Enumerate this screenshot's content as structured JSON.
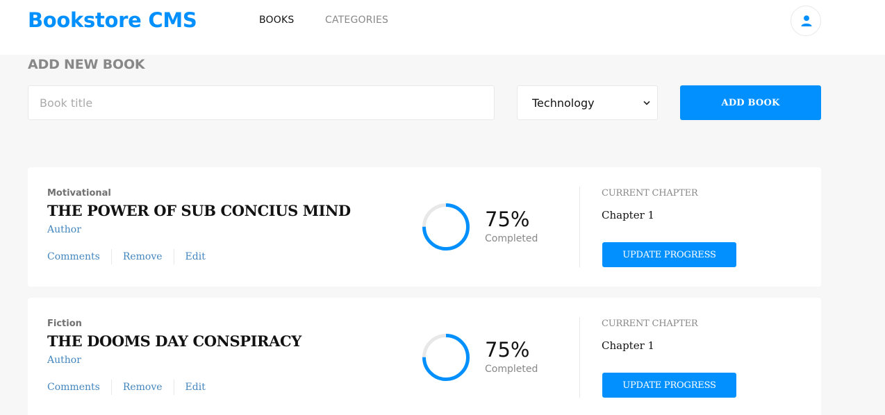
{
  "header": {
    "logo": "Bookstore CMS",
    "nav": [
      {
        "label": "BOOKS",
        "active": true
      },
      {
        "label": "CATEGORIES",
        "active": false
      }
    ],
    "user_icon": "user-icon"
  },
  "form": {
    "title": "ADD NEW BOOK",
    "title_placeholder": "Book title",
    "title_value": "",
    "category_selected": "Technology",
    "submit_label": "ADD BOOK"
  },
  "books": [
    {
      "category": "Motivational",
      "title": "THE POWER OF SUB CONCIUS MIND",
      "author": "Author",
      "actions": [
        "Comments",
        "Remove",
        "Edit"
      ],
      "progress": 75,
      "percent_label": "75%",
      "completed_label": "Completed",
      "chapter_label": "CURRENT CHAPTER",
      "chapter": "Chapter 1",
      "update_label": "UPDATE PROGRESS"
    },
    {
      "category": "Fiction",
      "title": "THE DOOMS DAY CONSPIRACY",
      "author": "Author",
      "actions": [
        "Comments",
        "Remove",
        "Edit"
      ],
      "progress": 75,
      "percent_label": "75%",
      "completed_label": "Completed",
      "chapter_label": "CURRENT CHAPTER",
      "chapter": "Chapter 1",
      "update_label": "UPDATE PROGRESS"
    }
  ],
  "colors": {
    "accent": "#0290ff",
    "link": "#4386bf",
    "ring_track": "#e8e8e8",
    "background": "#f7f7f7"
  }
}
